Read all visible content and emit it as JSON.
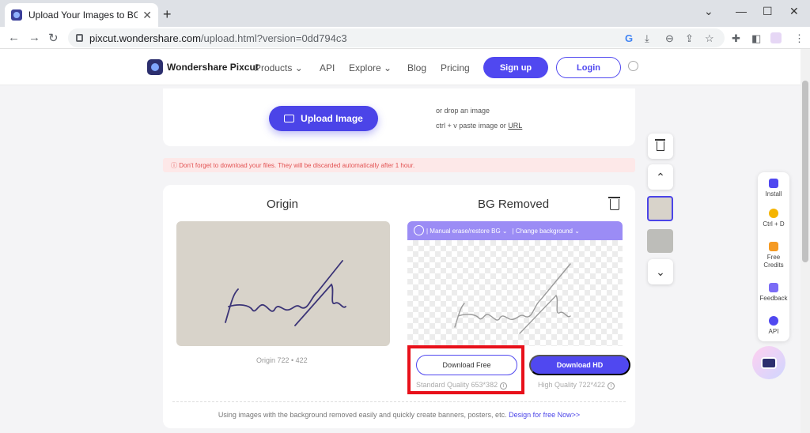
{
  "browser": {
    "tab_title": "Upload Your Images to BG Rem",
    "url_domain": "pixcut.wondershare.com",
    "url_path": "/upload.html?version=0dd794c3"
  },
  "site_nav": {
    "brand": "Wondershare Pixcut",
    "links": [
      "Products",
      "API",
      "Explore",
      "Blog",
      "Pricing"
    ],
    "signup": "Sign up",
    "login": "Login"
  },
  "upload": {
    "button": "Upload Image",
    "drop_hint": "or drop an image",
    "paste_hint": "ctrl + v paste image or ",
    "url_link": "URL"
  },
  "warning": "ⓘ Don't forget to download your files. They will be discarded automatically after 1 hour.",
  "result": {
    "origin_title": "Origin",
    "removed_title": "BG Removed",
    "origin_caption": "Origin 722 • 422",
    "toolbar_manual": "| Manual erase/restore BG ⌄",
    "toolbar_change": "| Change background ⌄",
    "download_free": "Download Free",
    "download_hd": "Download HD",
    "quality_free": "Standard Quality 653*382",
    "quality_hd": "High Quality 722*422",
    "footer": "Using images with the background removed easily and quickly create banners, posters, etc. ",
    "footer_link": "Design for free Now>>"
  },
  "side_tools": [
    "Install",
    "Ctrl + D",
    "Free Credits",
    "Feedback",
    "API"
  ],
  "colors": {
    "accent": "#5048f0",
    "highlight": "#e8101a",
    "warning_text": "#e25252"
  }
}
